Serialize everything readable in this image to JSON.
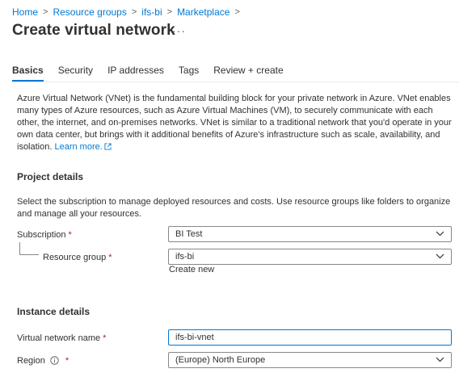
{
  "breadcrumb": [
    "Home",
    "Resource groups",
    "ifs-bi",
    "Marketplace"
  ],
  "breadcrumb_separator": ">",
  "page_title": "Create virtual network",
  "more_label": "···",
  "tabs": [
    {
      "label": "Basics",
      "active": true
    },
    {
      "label": "Security",
      "active": false
    },
    {
      "label": "IP addresses",
      "active": false
    },
    {
      "label": "Tags",
      "active": false
    },
    {
      "label": "Review + create",
      "active": false
    }
  ],
  "intro": {
    "text": "Azure Virtual Network (VNet) is the fundamental building block for your private network in Azure. VNet enables many types of Azure resources, such as Azure Virtual Machines (VM), to securely communicate with each other, the internet, and on-premises networks. VNet is similar to a traditional network that you'd operate in your own data center, but brings with it additional benefits of Azure's infrastructure such as scale, availability, and isolation.",
    "learn_more": "Learn more."
  },
  "project_details": {
    "title": "Project details",
    "description": "Select the subscription to manage deployed resources and costs. Use resource groups like folders to organize and manage all your resources.",
    "subscription": {
      "label": "Subscription",
      "required_mark": "*",
      "value": "BI Test"
    },
    "resource_group": {
      "label": "Resource group",
      "required_mark": "*",
      "value": "ifs-bi",
      "create_new": "Create new"
    }
  },
  "instance_details": {
    "title": "Instance details",
    "vnet_name": {
      "label": "Virtual network name",
      "required_mark": "*",
      "value": "ifs-bi-vnet"
    },
    "region": {
      "label": "Region",
      "required_mark": "*",
      "value": "(Europe) North Europe"
    }
  },
  "colors": {
    "accent": "#0078d4",
    "required": "#a4262c",
    "text": "#323130",
    "border": "#8a8886"
  }
}
